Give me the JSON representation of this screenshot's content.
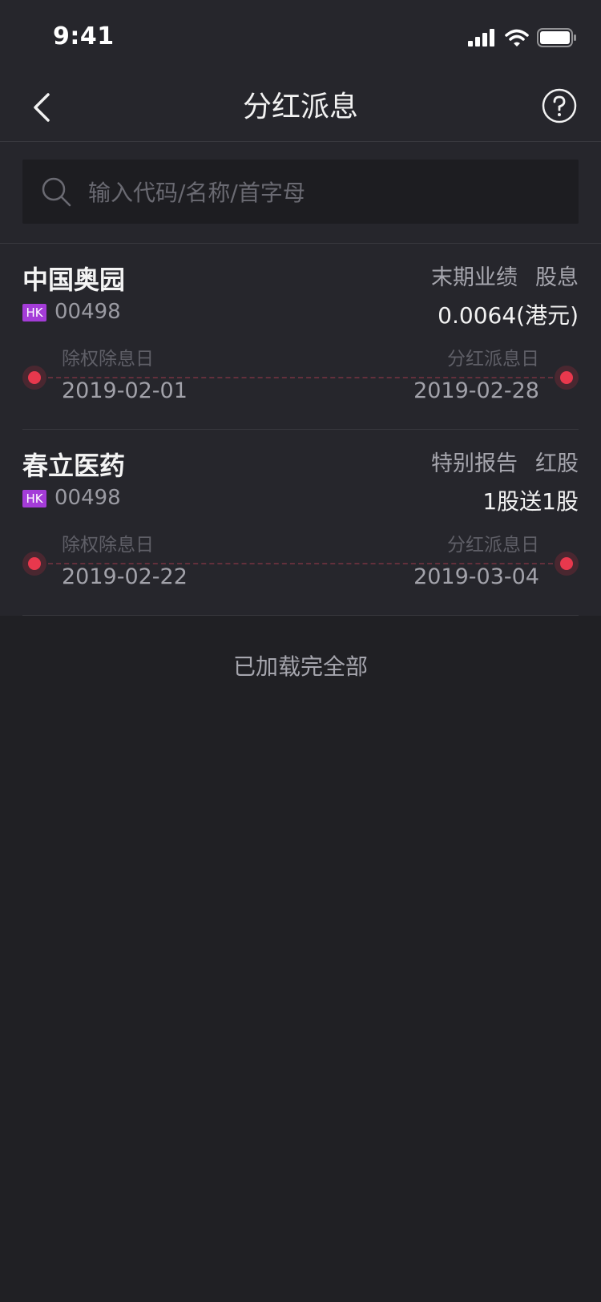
{
  "status_bar": {
    "time": "9:41"
  },
  "nav": {
    "title": "分红派息",
    "back_icon": "chevron-left-icon",
    "help_icon": "question-circle-icon"
  },
  "search": {
    "placeholder": "输入代码/名称/首字母",
    "value": ""
  },
  "items": [
    {
      "name": "中国奥园",
      "market": "HK",
      "code": "00498",
      "report_type": "末期业绩",
      "dividend_type": "股息",
      "amount": "0.0064(港元)",
      "ex_date_label": "除权除息日",
      "ex_date": "2019-02-01",
      "pay_date_label": "分红派息日",
      "pay_date": "2019-02-28"
    },
    {
      "name": "春立医药",
      "market": "HK",
      "code": "00498",
      "report_type": "特别报告",
      "dividend_type": "红股",
      "amount": "1股送1股",
      "ex_date_label": "除权除息日",
      "ex_date": "2019-02-22",
      "pay_date_label": "分红派息日",
      "pay_date": "2019-03-04"
    }
  ],
  "footer": {
    "text": "已加载完全部"
  },
  "colors": {
    "background": "#202024",
    "panel": "#26262c",
    "accent_red": "#e8384d",
    "badge_purple": "#a43cd8"
  }
}
